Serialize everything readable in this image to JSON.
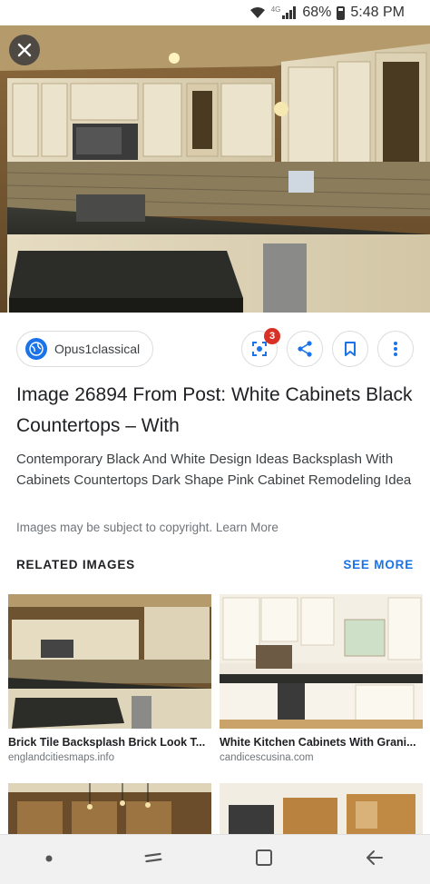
{
  "status_bar": {
    "network": "4G",
    "battery": "68%",
    "time": "5:48 PM"
  },
  "source": {
    "name": "Opus1classical",
    "icon": "globe-icon"
  },
  "actions": {
    "lens_badge": "3",
    "icons": [
      "lens-icon",
      "share-icon",
      "bookmark-icon",
      "more-vert-icon"
    ]
  },
  "title": "Image 26894 From Post: White Cabinets Black Countertops – With",
  "description": "Contemporary Black And White Design Ideas Backsplash With Cabinets Countertops Dark Shape Pink Cabinet Remodeling Idea",
  "copyright": "Images may be subject to copyright. Learn More",
  "related": {
    "heading": "RELATED IMAGES",
    "see_more": "SEE MORE",
    "items": [
      {
        "caption": "Brick Tile Backsplash Brick Look T...",
        "source": "englandcitiesmaps.info"
      },
      {
        "caption": "White Kitchen Cabinets With Grani...",
        "source": "candicescusina.com"
      }
    ]
  },
  "colors": {
    "accent": "#1a73e8",
    "badge": "#d93025"
  }
}
